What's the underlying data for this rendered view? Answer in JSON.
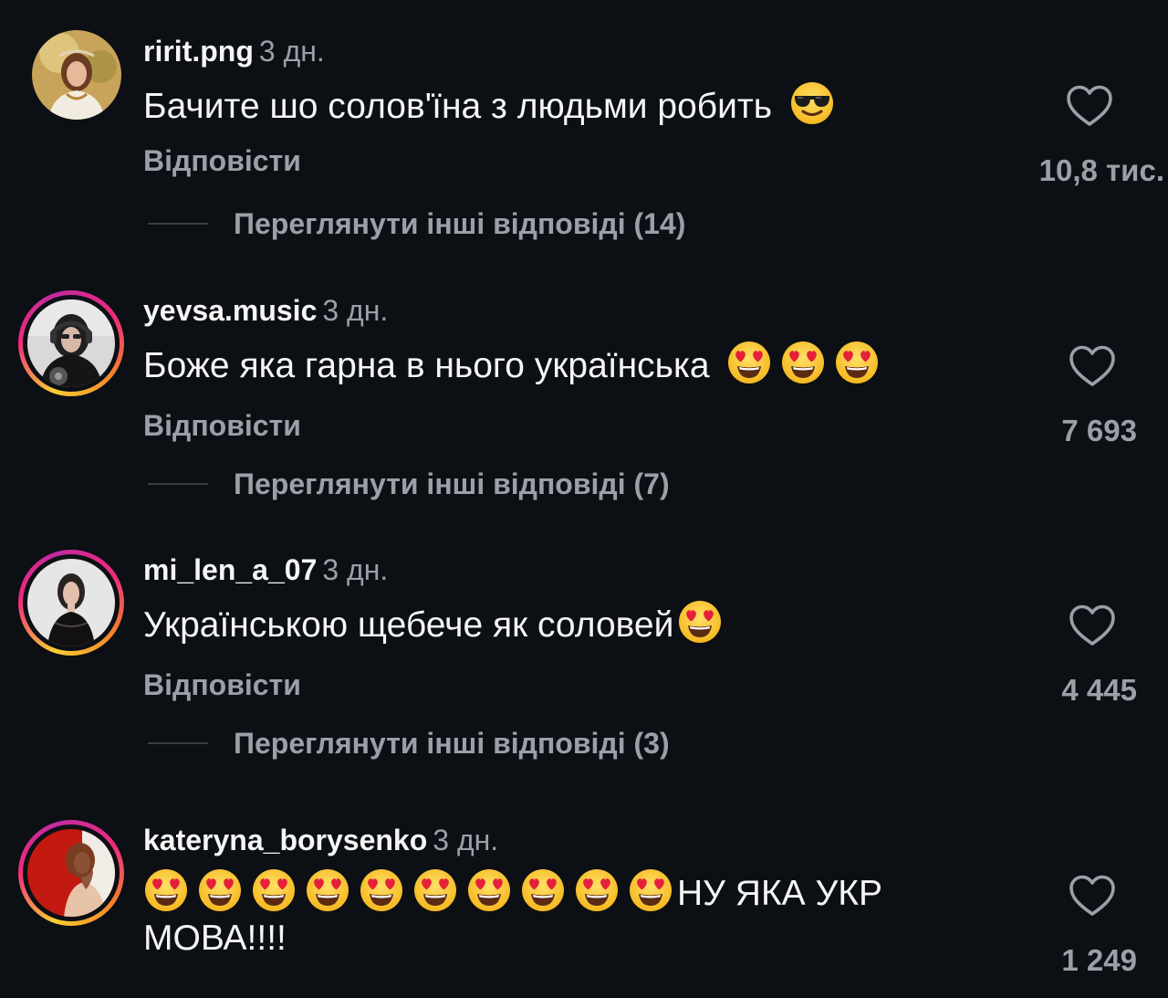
{
  "comments": [
    {
      "username": "ririt.png",
      "time": "3 дн.",
      "text": "Бачите шо солов'їна з людьми робить",
      "emojis": [
        "smiling-face-with-sunglasses"
      ],
      "reply_label": "Відповісти",
      "view_replies": "Переглянути інші відповіді (14)",
      "likes": "10,8 тис.",
      "has_story_ring": false
    },
    {
      "username": "yevsa.music",
      "time": "3 дн.",
      "text": "Боже яка гарна в нього українська",
      "emojis": [
        "heart-eyes",
        "heart-eyes",
        "heart-eyes"
      ],
      "reply_label": "Відповісти",
      "view_replies": "Переглянути інші відповіді (7)",
      "likes": "7 693",
      "has_story_ring": true
    },
    {
      "username": "mi_len_a_07",
      "time": "3 дн.",
      "text": "Українською щебече як соловей",
      "emojis": [
        "heart-eyes"
      ],
      "reply_label": "Відповісти",
      "view_replies": "Переглянути інші відповіді (3)",
      "likes": "4 445",
      "has_story_ring": true
    },
    {
      "username": "kateryna_borysenko",
      "time": "3 дн.",
      "text_line1": "НУ ЯКА УКР",
      "text_line2": "МОВА!!!!",
      "emojis": [
        "heart-eyes",
        "heart-eyes",
        "heart-eyes",
        "heart-eyes",
        "heart-eyes",
        "heart-eyes",
        "heart-eyes",
        "heart-eyes",
        "heart-eyes",
        "heart-eyes"
      ],
      "likes": "1 249",
      "has_story_ring": true
    }
  ],
  "colors": {
    "background": "#0c0f14",
    "primary_text": "#f5f5f5",
    "secondary_text": "#9aa0a8",
    "story_ring_start": "#f9ce34",
    "story_ring_end": "#c32aa3"
  }
}
